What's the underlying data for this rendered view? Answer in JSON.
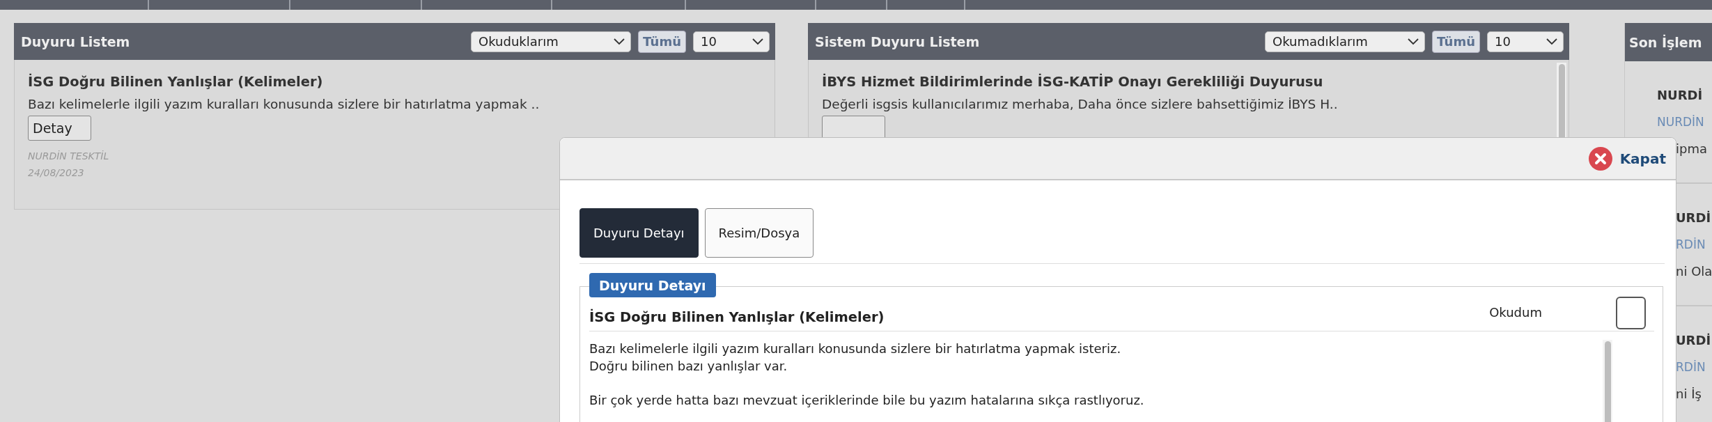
{
  "panels": [
    {
      "title": "Duyuru Listem",
      "filter": "Okuduklarım",
      "all_button": "Tümü",
      "page_size": "10",
      "scrollbar": false,
      "items": [
        {
          "title": "İSG Doğru Bilinen Yanlışlar (Kelimeler)",
          "summary": "Bazı kelimelerle ilgili yazım kuralları konusunda sizlere bir hatırlatma yapmak ..",
          "button": "Detay",
          "author": "NURDİN TESKTİL",
          "date": "24/08/2023"
        }
      ]
    },
    {
      "title": "Sistem Duyuru Listem",
      "filter": "Okumadıklarım",
      "all_button": "Tümü",
      "page_size": "10",
      "scrollbar": true,
      "items": [
        {
          "title": "İBYS Hizmet Bildirimlerinde İSG-KATİP Onayı Gerekliliği Duyurusu",
          "summary": "Değerli isgsis kullanıcılarımız merhaba, Daha önce sizlere bahsettiğimiz İBYS H.."
        }
      ]
    }
  ],
  "recent_panel": {
    "title": "Son İşlem",
    "items": [
      {
        "title": "NURDİ",
        "user": "NURDİN",
        "text": "ipma"
      },
      {
        "title": "URDİ",
        "user": "RDİN",
        "text": "ni Ola"
      },
      {
        "title": "URDİ",
        "user": "RDİN",
        "text": "ni İş"
      }
    ]
  },
  "modal": {
    "close_button": "Kapat",
    "tabs": [
      {
        "label": "Duyuru Detayı",
        "selected": true
      },
      {
        "label": "Resim/Dosya",
        "selected": false
      }
    ],
    "legend": "Duyuru Detayı",
    "read_label": "Okudum",
    "read_checked": false,
    "title": "İSG Doğru Bilinen Yanlışlar (Kelimeler)",
    "paragraphs": [
      [
        "Bazı kelimelerle ilgili yazım kuralları konusunda sizlere bir hatırlatma yapmak isteriz.",
        "Doğru bilinen bazı yanlışlar var."
      ],
      [
        "Bir çok yerde hatta bazı mevzuat içeriklerinde bile bu yazım hatalarına sıkça rastlıyoruz."
      ]
    ]
  }
}
